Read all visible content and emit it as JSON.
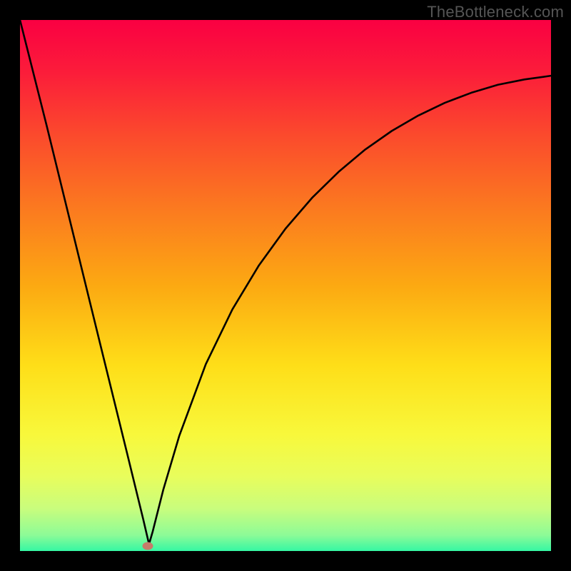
{
  "watermark": "TheBottleneck.com",
  "gradient_stops": [
    {
      "offset": 0.0,
      "color": "#fa0042"
    },
    {
      "offset": 0.1,
      "color": "#fb1d3a"
    },
    {
      "offset": 0.22,
      "color": "#fb4b2c"
    },
    {
      "offset": 0.35,
      "color": "#fb7820"
    },
    {
      "offset": 0.5,
      "color": "#fca912"
    },
    {
      "offset": 0.65,
      "color": "#fede18"
    },
    {
      "offset": 0.78,
      "color": "#f8f83b"
    },
    {
      "offset": 0.86,
      "color": "#e8fd5c"
    },
    {
      "offset": 0.92,
      "color": "#c9fd7d"
    },
    {
      "offset": 0.97,
      "color": "#8dfb97"
    },
    {
      "offset": 1.0,
      "color": "#35f7a3"
    }
  ],
  "marker": {
    "x_frac": 0.24,
    "y_frac": 0.99,
    "color": "#c77b6a"
  },
  "chart_data": {
    "type": "line",
    "title": "",
    "xlabel": "",
    "ylabel": "",
    "x_range": [
      0,
      1
    ],
    "y_range": [
      0,
      1
    ],
    "note": "x and y are normalized plot-area fractions; y=0 is top, y=1 is bottom. Curve descends steeply from top-left to a minimum near x≈0.24 (marker), then rises with decelerating slope toward upper-right.",
    "series": [
      {
        "name": "bottleneck-curve",
        "points": [
          {
            "x": 0.0,
            "y": 0.0
          },
          {
            "x": 0.05,
            "y": 0.198
          },
          {
            "x": 0.1,
            "y": 0.402
          },
          {
            "x": 0.15,
            "y": 0.606
          },
          {
            "x": 0.2,
            "y": 0.809
          },
          {
            "x": 0.232,
            "y": 0.94
          },
          {
            "x": 0.243,
            "y": 0.987
          },
          {
            "x": 0.25,
            "y": 0.963
          },
          {
            "x": 0.27,
            "y": 0.884
          },
          {
            "x": 0.3,
            "y": 0.783
          },
          {
            "x": 0.35,
            "y": 0.648
          },
          {
            "x": 0.4,
            "y": 0.545
          },
          {
            "x": 0.45,
            "y": 0.462
          },
          {
            "x": 0.5,
            "y": 0.393
          },
          {
            "x": 0.55,
            "y": 0.335
          },
          {
            "x": 0.6,
            "y": 0.286
          },
          {
            "x": 0.65,
            "y": 0.244
          },
          {
            "x": 0.7,
            "y": 0.209
          },
          {
            "x": 0.75,
            "y": 0.18
          },
          {
            "x": 0.8,
            "y": 0.156
          },
          {
            "x": 0.85,
            "y": 0.137
          },
          {
            "x": 0.9,
            "y": 0.122
          },
          {
            "x": 0.95,
            "y": 0.112
          },
          {
            "x": 1.0,
            "y": 0.105
          }
        ]
      }
    ],
    "marker_point": {
      "x": 0.243,
      "y": 0.987
    }
  }
}
